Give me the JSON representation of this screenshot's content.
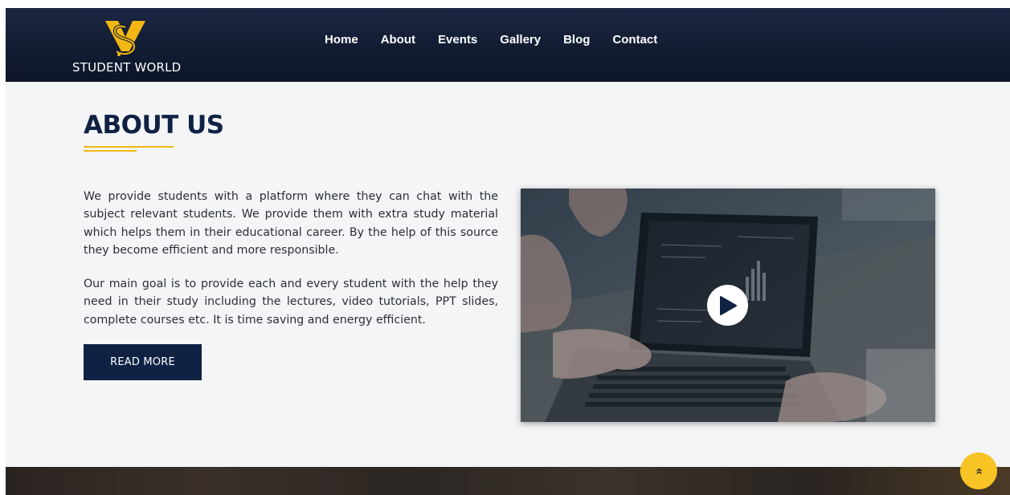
{
  "brand": {
    "name": "STUDENT WORLD",
    "logo_icon": "sw-monogram-icon",
    "accent_color": "#f2b713"
  },
  "nav": {
    "items": [
      {
        "label": "Home"
      },
      {
        "label": "About"
      },
      {
        "label": "Events"
      },
      {
        "label": "Gallery"
      },
      {
        "label": "Blog"
      },
      {
        "label": "Contact"
      }
    ]
  },
  "about": {
    "title": "ABOUT US",
    "paragraph_1": "We provide students with a platform where they can chat with the subject relevant students. We provide them with extra study material which helps them in their educational career. By the help of this source they become efficient and more responsible.",
    "paragraph_2": "Our main goal is to provide each and every student with the help they need in their study including the lectures, video tutorials, PPT slides, complete courses etc. It is time saving and energy efficient.",
    "button_label": "READ MORE",
    "button_color": "#0f2244"
  },
  "video": {
    "thumbnail": "laptop-typing-image",
    "play_icon": "play-icon"
  },
  "scroll_top": {
    "icon": "double-chevron-up-icon",
    "glyph": "»",
    "color": "#f7c325"
  },
  "colors": {
    "header_bg": "#121c33",
    "page_bg": "#f4f5f7",
    "heading": "#0f2244"
  }
}
